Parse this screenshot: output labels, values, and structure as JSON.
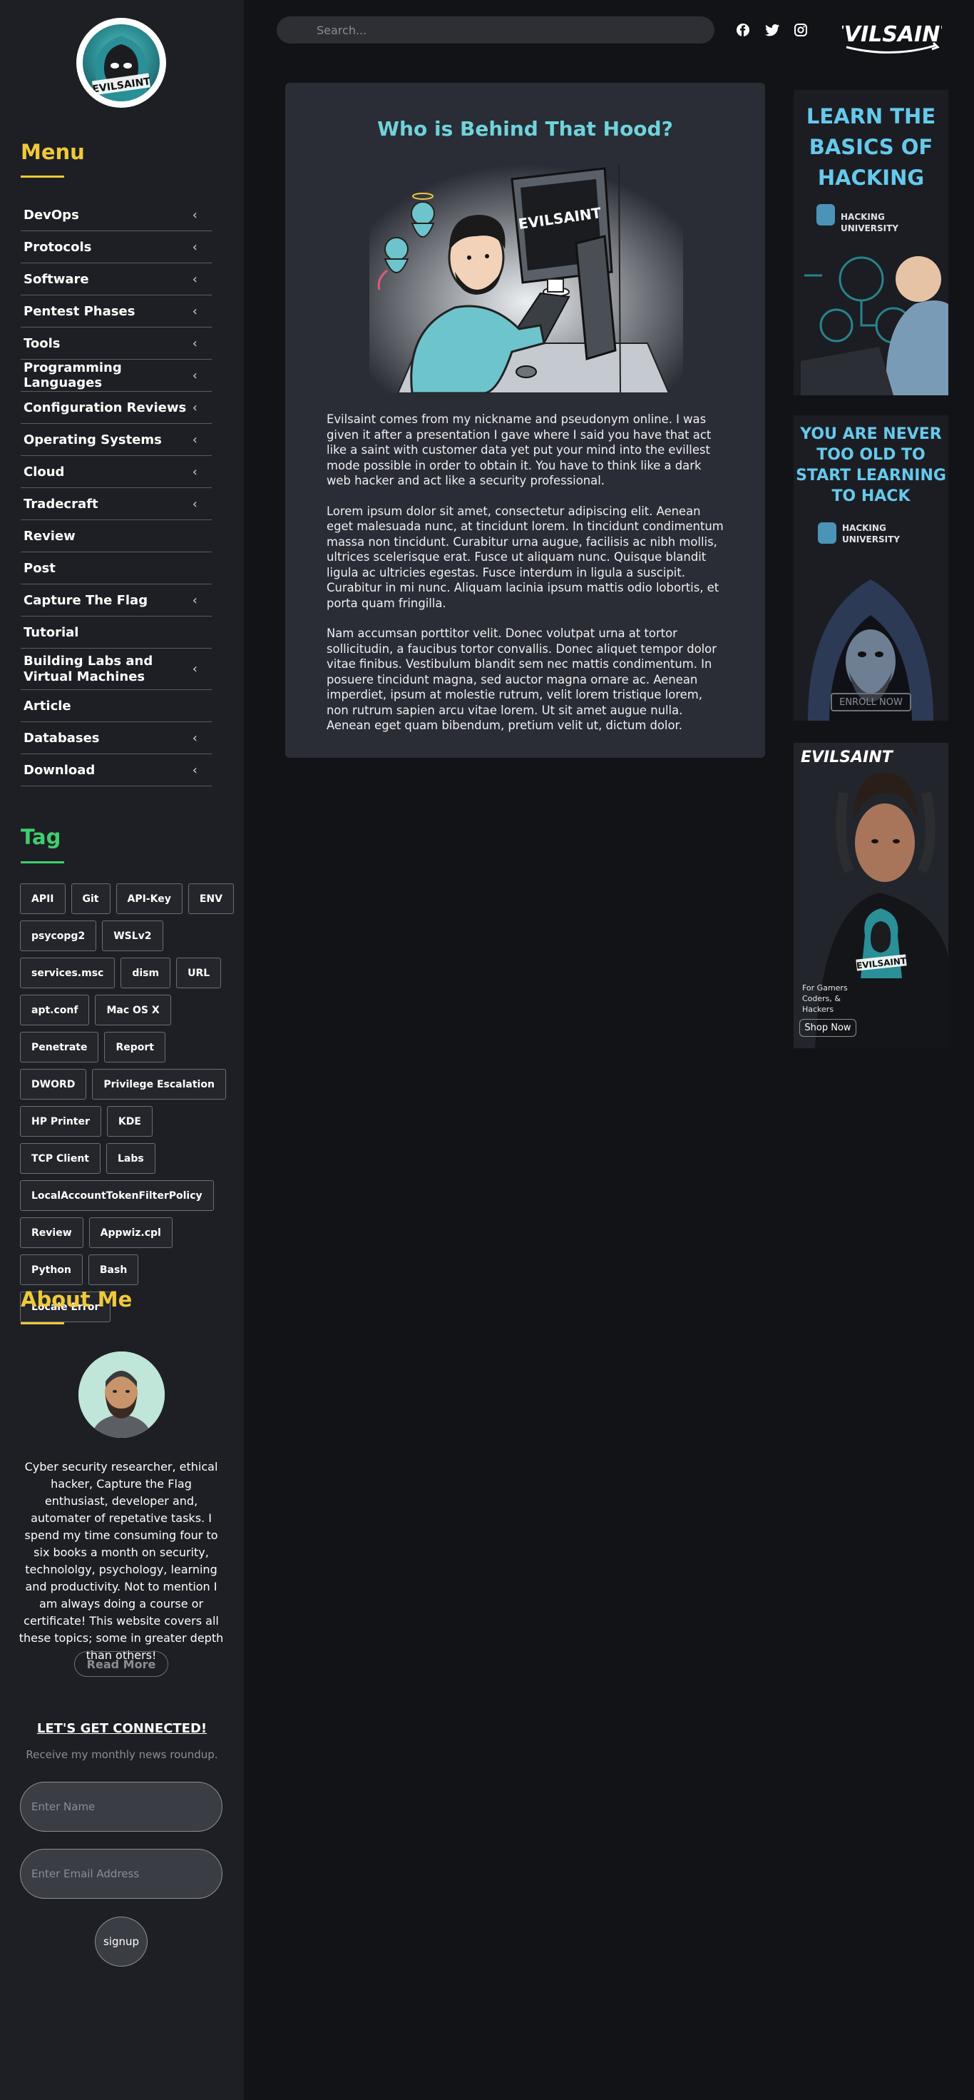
{
  "site": {
    "logo_text": "EVILSAINT",
    "brand_text": "EVILSAINT"
  },
  "topbar": {
    "search_placeholder": "Search...",
    "social": [
      "facebook-icon",
      "twitter-icon",
      "instagram-icon"
    ]
  },
  "sidebar": {
    "menu_title": "Menu",
    "menu": [
      {
        "label": "DevOps",
        "has_children": true
      },
      {
        "label": "Protocols",
        "has_children": true
      },
      {
        "label": "Software",
        "has_children": true
      },
      {
        "label": "Pentest Phases",
        "has_children": true
      },
      {
        "label": "Tools",
        "has_children": true
      },
      {
        "label": "Programming Languages",
        "has_children": true
      },
      {
        "label": "Configuration Reviews",
        "has_children": true
      },
      {
        "label": "Operating Systems",
        "has_children": true
      },
      {
        "label": "Cloud",
        "has_children": true
      },
      {
        "label": "Tradecraft",
        "has_children": true
      },
      {
        "label": "Review",
        "has_children": false
      },
      {
        "label": "Post",
        "has_children": false
      },
      {
        "label": "Capture The Flag",
        "has_children": true
      },
      {
        "label": "Tutorial",
        "has_children": false
      },
      {
        "label": "Building Labs and Virtual Machines",
        "has_children": true
      },
      {
        "label": "Article",
        "has_children": false
      },
      {
        "label": "Databases",
        "has_children": true
      },
      {
        "label": "Download",
        "has_children": true
      }
    ],
    "tag_title": "Tag",
    "tags": [
      "APII",
      "Git",
      "API-Key",
      "ENV",
      "psycopg2",
      "WSLv2",
      "services.msc",
      "dism",
      "URL",
      "apt.conf",
      "Mac OS X",
      "Penetrate",
      "Report",
      "DWORD",
      "Privilege Escalation",
      "HP Printer",
      "KDE",
      "TCP Client",
      "Labs",
      "LocalAccountTokenFilterPolicy",
      "Review",
      "Appwiz.cpl",
      "Python",
      "Bash",
      "Locale Error"
    ],
    "about_title": "About Me",
    "about_text": "Cyber security researcher, ethical hacker, Capture the Flag enthusiast, developer and, automater of repetative tasks. I spend my time consuming four to six books a month on security, technololgy, psychology, learning and productivity. Not to mention I am always doing a course or certificate! This website covers all these topics; some in greater depth than others!",
    "read_more": "Read More",
    "connect_title": "LET'S GET CONNECTED!",
    "connect_sub": "Receive my monthly news roundup.",
    "name_placeholder": "Enter Name",
    "email_placeholder": "Enter Email Address",
    "signup": "signup"
  },
  "main": {
    "title": "Who is Behind That Hood?",
    "hero_logo_text": "EVILSAINT",
    "paragraphs": [
      "Evilsaint comes from my nickname and pseudonym online. I was given it after a presentation I gave where I said you have that act like a saint with customer data yet put your mind into the evillest mode possible in order to obtain it. You have to think like a dark web hacker and act like a security professional.",
      "Lorem ipsum dolor sit amet, consectetur adipiscing elit. Aenean eget malesuada nunc, at tincidunt lorem. In tincidunt condimentum massa non tincidunt. Curabitur urna augue, facilisis ac nibh mollis, ultrices scelerisque erat. Fusce ut aliquam nunc. Quisque blandit ligula ac ultricies egestas. Fusce interdum in ligula a suscipit. Curabitur in mi nunc. Aliquam lacinia ipsum mattis odio lobortis, et porta quam fringilla.",
      "Nam accumsan porttitor velit. Donec volutpat urna at tortor sollicitudin, a faucibus tortor convallis. Donec aliquet tempor dolor vitae finibus. Vestibulum blandit sem nec mattis condimentum. In posuere tincidunt magna, sed auctor magna ornare ac. Aenean imperdiet, ipsum at molestie rutrum, velit lorem tristique lorem, non rutrum sapien arcu vitae lorem. Ut sit amet augue nulla. Aenean eget quam bibendum, pretium velit ut, dictum dolor."
    ]
  },
  "ads": {
    "ad1": {
      "headline": "LEARN THE BASICS OF HACKING",
      "brand": "HACKING UNIVERSITY"
    },
    "ad2": {
      "headline": "YOU ARE NEVER TOO OLD TO START LEARNING TO HACK",
      "brand": "HACKING UNIVERSITY",
      "cta": "ENROLL NOW"
    },
    "ad3": {
      "brand": "EVILSAINT",
      "shirt_text": "EVILSAINT",
      "tagline": "For Gamers Coders, & Hackers",
      "cta": "Shop Now"
    }
  },
  "colors": {
    "menu_title": "#f0c93a",
    "tag_title": "#3ecf6e",
    "about_title": "#f0c93a",
    "card_title": "#6fd3dc",
    "accent_teal": "#5ec8c8"
  }
}
